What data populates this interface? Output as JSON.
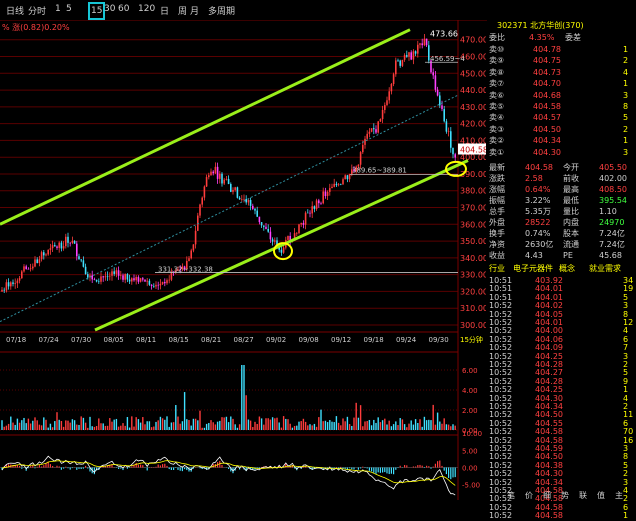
{
  "toolbar": {
    "items": [
      "日线",
      "分时",
      "1",
      "5",
      "15",
      "30",
      "60",
      "120",
      "日",
      "周",
      "月",
      "多周期"
    ],
    "selected_index": 4
  },
  "indicator_header": {
    "text": "% 涨(0.82)0.20%"
  },
  "price_axis": {
    "ticks": [
      "470.00",
      "460.00",
      "450.00",
      "440.00",
      "430.00",
      "420.00",
      "410.00",
      "400.00",
      "390.00",
      "380.00",
      "370.00",
      "360.00",
      "350.00",
      "340.00",
      "330.00",
      "320.00",
      "310.00",
      "300.00"
    ]
  },
  "time_axis": {
    "ticks": [
      "07/18",
      "07/24",
      "07/30",
      "08/05",
      "08/11",
      "08/15",
      "08/21",
      "08/27",
      "09/02",
      "09/08",
      "09/12",
      "09/18",
      "09/24",
      "09/30"
    ]
  },
  "annotations": {
    "high": "473.66",
    "mid_high": "456.59~4",
    "label_mid": "389.65~389.81",
    "label_low": "331.32~332.38",
    "last_price": "404.58",
    "sub_label": "15分钟"
  },
  "volume_axis": {
    "ticks": [
      "6.00",
      "4.00",
      "2.00",
      "0.00"
    ],
    "unit": "万"
  },
  "macd_axis": {
    "ticks": [
      "10.00",
      "5.00",
      "0.00",
      "-5.00",
      "-10.00"
    ]
  },
  "quote": {
    "code_name": "302371 北方华创(370)",
    "sell_header": "委比",
    "ratio": "4.35%",
    "ratio_label": "委差",
    "sell": [
      {
        "label": "卖⑩",
        "price": "404.78",
        "vol": "1"
      },
      {
        "label": "卖⑨",
        "price": "404.75",
        "vol": "2"
      },
      {
        "label": "卖⑧",
        "price": "404.73",
        "vol": "4"
      },
      {
        "label": "卖⑦",
        "price": "404.70",
        "vol": "1"
      },
      {
        "label": "卖⑥",
        "price": "404.68",
        "vol": "3"
      },
      {
        "label": "卖⑤",
        "price": "404.58",
        "vol": "8"
      },
      {
        "label": "卖④",
        "price": "404.57",
        "vol": "5"
      },
      {
        "label": "卖③",
        "price": "404.50",
        "vol": "2"
      },
      {
        "label": "卖②",
        "price": "404.34",
        "vol": "1"
      },
      {
        "label": "卖①",
        "price": "404.30",
        "vol": "3"
      }
    ],
    "stats": [
      {
        "l1": "最新",
        "v1": "404.58",
        "l2": "今开",
        "v2": "405.50",
        "c1": "#ff4040",
        "c2": "#ff4040"
      },
      {
        "l1": "涨跌",
        "v1": "2.58",
        "l2": "前收",
        "v2": "402.00",
        "c1": "#ff4040",
        "c2": "#d0d0d0"
      },
      {
        "l1": "涨幅",
        "v1": "0.64%",
        "l2": "最高",
        "v2": "408.50",
        "c1": "#ff4040",
        "c2": "#ff4040"
      },
      {
        "l1": "振幅",
        "v1": "3.22%",
        "l2": "最低",
        "v2": "395.54",
        "c1": "#d0d0d0",
        "c2": "#40ff40"
      },
      {
        "l1": "总手",
        "v1": "5.35万",
        "l2": "量比",
        "v2": "1.10",
        "c1": "#d0d0d0",
        "c2": "#d0d0d0"
      },
      {
        "l1": "外盘",
        "v1": "28522",
        "l2": "内盘",
        "v2": "24970",
        "c1": "#ff4040",
        "c2": "#40ff40"
      },
      {
        "l1": "换手",
        "v1": "0.74%",
        "l2": "股本",
        "v2": "7.24亿",
        "c1": "#d0d0d0",
        "c2": "#d0d0d0"
      },
      {
        "l1": "净资",
        "v1": "2630亿",
        "l2": "流通",
        "v2": "7.24亿",
        "c1": "#d0d0d0",
        "c2": "#d0d0d0"
      },
      {
        "l1": "收益",
        "v1": "4.43",
        "l2": "PE",
        "v2": "45.68",
        "c1": "#d0d0d0",
        "c2": "#d0d0d0"
      }
    ],
    "sector_bar": {
      "a": "行业",
      "b": "电子元器件",
      "c": "概念",
      "d": "就业需求"
    },
    "ticks": [
      {
        "t": "10:51",
        "p": "403.92",
        "v": "34"
      },
      {
        "t": "10:51",
        "p": "404.01",
        "v": "19"
      },
      {
        "t": "10:51",
        "p": "404.01",
        "v": "5"
      },
      {
        "t": "10:52",
        "p": "404.02",
        "v": "3"
      },
      {
        "t": "10:52",
        "p": "404.05",
        "v": "8"
      },
      {
        "t": "10:52",
        "p": "404.01",
        "v": "12"
      },
      {
        "t": "10:52",
        "p": "404.00",
        "v": "4"
      },
      {
        "t": "10:52",
        "p": "404.06",
        "v": "6"
      },
      {
        "t": "10:52",
        "p": "404.09",
        "v": "7"
      },
      {
        "t": "10:52",
        "p": "404.25",
        "v": "3"
      },
      {
        "t": "10:52",
        "p": "404.28",
        "v": "2"
      },
      {
        "t": "10:52",
        "p": "404.27",
        "v": "5"
      },
      {
        "t": "10:52",
        "p": "404.28",
        "v": "9"
      },
      {
        "t": "10:52",
        "p": "404.25",
        "v": "1"
      },
      {
        "t": "10:52",
        "p": "404.30",
        "v": "4"
      },
      {
        "t": "10:52",
        "p": "404.34",
        "v": "2"
      },
      {
        "t": "10:52",
        "p": "404.50",
        "v": "11"
      },
      {
        "t": "10:52",
        "p": "404.55",
        "v": "6"
      },
      {
        "t": "10:52",
        "p": "404.58",
        "v": "70"
      },
      {
        "t": "10:52",
        "p": "404.58",
        "v": "16"
      },
      {
        "t": "10:52",
        "p": "404.59",
        "v": "3"
      },
      {
        "t": "10:52",
        "p": "404.50",
        "v": "8"
      },
      {
        "t": "10:52",
        "p": "404.38",
        "v": "5"
      },
      {
        "t": "10:52",
        "p": "404.30",
        "v": "2"
      },
      {
        "t": "10:52",
        "p": "404.34",
        "v": "3"
      },
      {
        "t": "10:52",
        "p": "404.58",
        "v": "4"
      },
      {
        "t": "10:52",
        "p": "404.58",
        "v": "2"
      },
      {
        "t": "10:52",
        "p": "404.58",
        "v": "6"
      },
      {
        "t": "10:52",
        "p": "404.58",
        "v": "1"
      }
    ],
    "bottom_tabs": [
      "笔",
      "价",
      "细",
      "势",
      "联",
      "值",
      "主"
    ]
  },
  "colors": {
    "up": "#ff3c3c",
    "down": "#40e0ff",
    "channel": "#9aef1a",
    "ma": "#ffff00",
    "bg": "#000000",
    "grid": "#5a0000"
  }
}
